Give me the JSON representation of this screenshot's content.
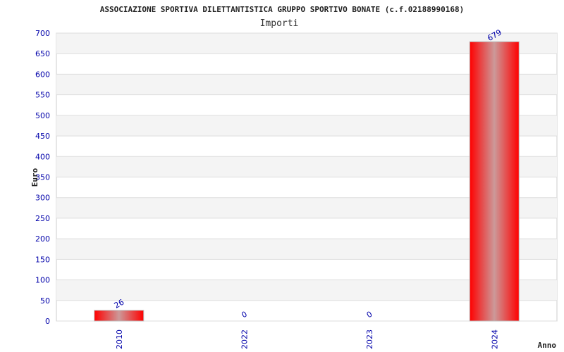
{
  "chart_data": {
    "type": "bar",
    "title": "ASSOCIAZIONE SPORTIVA DILETTANTISTICA GRUPPO SPORTIVO BONATE (c.f.02188990168)",
    "subtitle": "Importi",
    "xlabel": "Anno",
    "ylabel": "Euro",
    "categories": [
      "2010",
      "2022",
      "2023",
      "2024"
    ],
    "values": [
      26,
      0,
      0,
      679
    ],
    "value_labels": [
      "26",
      "0",
      "0",
      "679"
    ],
    "ylim": [
      0,
      700
    ],
    "yticks": [
      0,
      50,
      100,
      150,
      200,
      250,
      300,
      350,
      400,
      450,
      500,
      550,
      600,
      650,
      700
    ],
    "grid": true,
    "colors": {
      "bar_edge": "#ff0000",
      "bar_center": "#cc9999",
      "tick_text": "#0000aa",
      "band_alt": "#f4f4f4"
    }
  }
}
